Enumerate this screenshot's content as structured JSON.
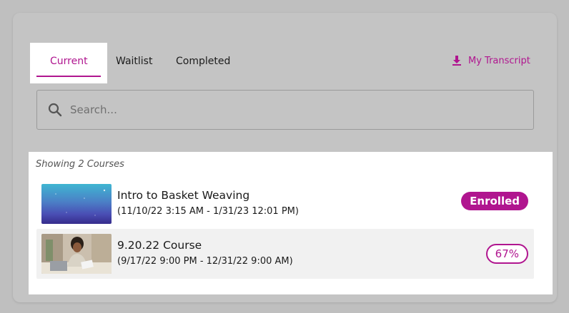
{
  "tabs": {
    "current": "Current",
    "waitlist": "Waitlist",
    "completed": "Completed"
  },
  "transcript": {
    "label": "My Transcript",
    "icon": "download-icon"
  },
  "search": {
    "placeholder": "Search...",
    "value": ""
  },
  "list": {
    "showing_label": "Showing 2 Courses",
    "courses": [
      {
        "title": "Intro to Basket Weaving",
        "dates": "(11/10/22 3:15 AM - 1/31/23 12:01 PM)",
        "status": "Enrolled"
      },
      {
        "title": "9.20.22 Course",
        "dates": "(9/17/22 9:00 PM - 12/31/22 9:00 AM)",
        "status": "67%"
      }
    ]
  },
  "colors": {
    "accent": "#b0158f",
    "background": "#bfbfbf",
    "card": "#c4c4c4"
  }
}
